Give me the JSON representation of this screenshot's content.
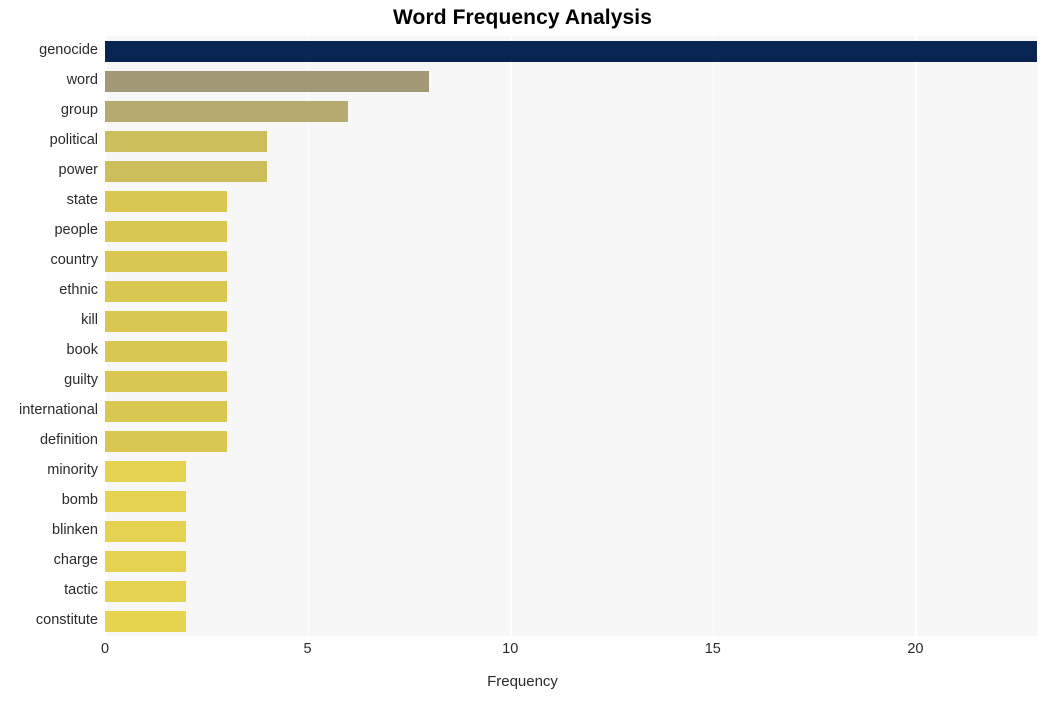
{
  "chart_data": {
    "type": "bar",
    "orientation": "horizontal",
    "title": "Word Frequency Analysis",
    "xlabel": "Frequency",
    "ylabel": "",
    "xlim": [
      0,
      23
    ],
    "ylim": [
      0,
      20
    ],
    "xticks": [
      "0",
      "5",
      "10",
      "15",
      "20"
    ],
    "xtick_values": [
      0,
      5,
      10,
      15,
      20
    ],
    "grid": "vertical-white-on-light-gray",
    "legend": "none",
    "categories": [
      "genocide",
      "word",
      "group",
      "political",
      "power",
      "state",
      "people",
      "country",
      "ethnic",
      "kill",
      "book",
      "guilty",
      "international",
      "definition",
      "minority",
      "bomb",
      "blinken",
      "charge",
      "tactic",
      "constitute"
    ],
    "values": [
      23,
      8,
      6,
      4,
      4,
      3,
      3,
      3,
      3,
      3,
      3,
      3,
      3,
      3,
      2,
      2,
      2,
      2,
      2,
      2
    ],
    "bar_colors": [
      "#082450",
      "#a29a76",
      "#b5aa70",
      "#cdbe5c",
      "#cdbe5c",
      "#d8c852",
      "#d8c852",
      "#d8c852",
      "#d8c852",
      "#d8c852",
      "#d8c852",
      "#d8c852",
      "#d8c852",
      "#d8c852",
      "#e4d250",
      "#e4d250",
      "#e4d250",
      "#e4d250",
      "#e4d250",
      "#e7d44e"
    ],
    "plot_background": "#f7f7f7",
    "gridline_color": "#ffffff",
    "title_color": "#000000",
    "tick_color": "#2b2b2b"
  }
}
